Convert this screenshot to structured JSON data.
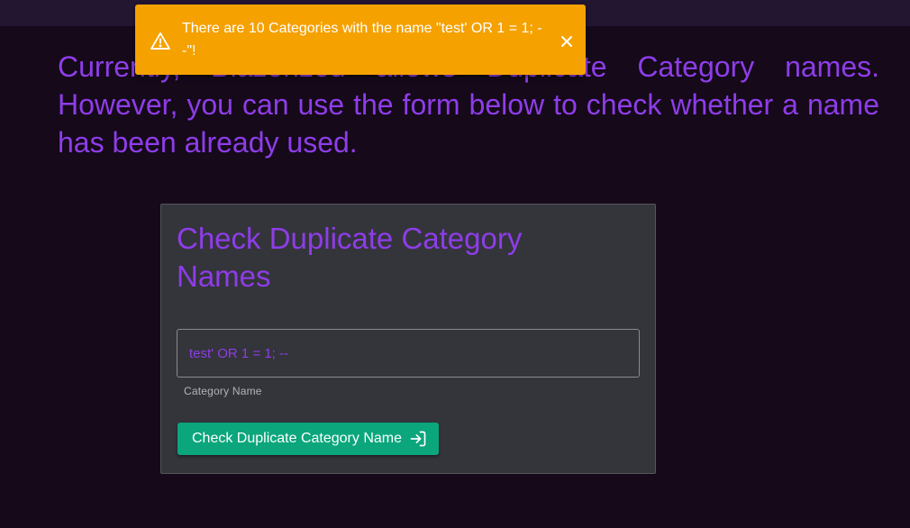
{
  "intro": {
    "text": "Currently, Blazorized allows Duplicate Category names. However, you can use the form below to check whether a name has been already used."
  },
  "card": {
    "title": "Check Duplicate Category Names",
    "input": {
      "value": "test' OR 1 = 1; --",
      "label": "Category Name"
    },
    "button": {
      "label": "Check Duplicate Category Name",
      "icon": "login-icon"
    }
  },
  "alert": {
    "message": "There are 10 Categories with the name \"test' OR 1 = 1; --\"!",
    "icon": "warning-icon",
    "close_icon": "close-icon",
    "color": "#f5a100"
  },
  "colors": {
    "background": "#15091a",
    "accent": "#8e3de8",
    "card": "#34343b",
    "button": "#0ba67c"
  }
}
